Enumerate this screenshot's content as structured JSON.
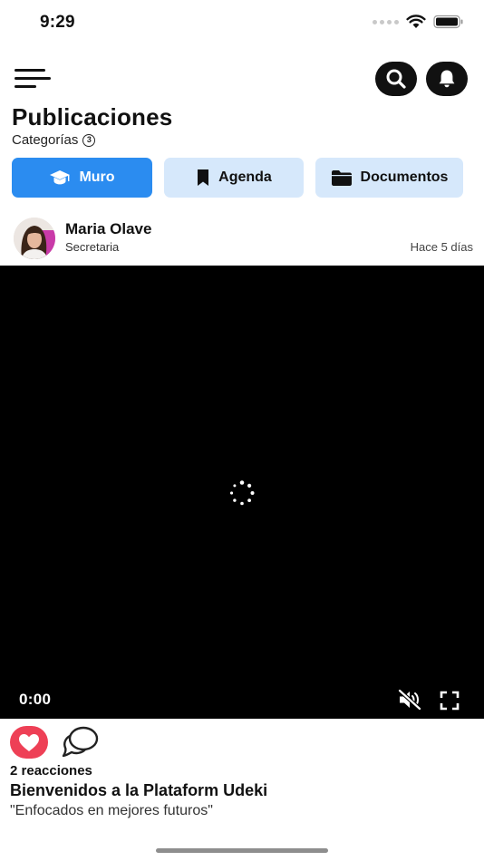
{
  "status_bar": {
    "time": "9:29",
    "icons": [
      "signal-dots-icon",
      "wifi-icon",
      "battery-icon"
    ]
  },
  "top_bar": {
    "icons": [
      "menu-icon",
      "search-icon",
      "bell-icon"
    ]
  },
  "header": {
    "title": "Publicaciones",
    "categories_label": "Categorías",
    "categories_count": "3"
  },
  "tabs": [
    {
      "label": "Muro",
      "icon": "graduation-cap-icon",
      "active": true
    },
    {
      "label": "Agenda",
      "icon": "bookmark-icon",
      "active": false
    },
    {
      "label": "Documentos",
      "icon": "folder-icon",
      "active": false
    }
  ],
  "post": {
    "author_name": "Maria Olave",
    "author_role": "Secretaria",
    "time_ago": "Hace 5 días",
    "video": {
      "current_time": "0:00",
      "state": "loading",
      "muted": true
    },
    "reactions_label": "2 reacciones",
    "title": "Bienvenidos a la Plataform Udeki",
    "subtitle": "\"Enfocados en mejores futuros\""
  },
  "colors": {
    "accent": "#2b8cf0",
    "tab_inactive_bg": "#d6e8fb",
    "like": "#ee4056",
    "video_bg": "#000000"
  }
}
